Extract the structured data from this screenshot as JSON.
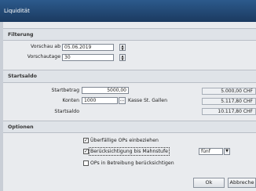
{
  "window": {
    "title": "Liquidität"
  },
  "filterung": {
    "title": "Filterung",
    "vorschau_ab_label": "Vorschau ab",
    "vorschau_ab_value": "05.06.2019",
    "vorschautage_label": "Vorschautage",
    "vorschautage_value": "30"
  },
  "startsaldo": {
    "title": "Startsaldo",
    "startbetrag_label": "Startbetrag",
    "startbetrag_value": "5000,00",
    "startbetrag_display": "5.000,00 CHF",
    "konten_label": "Konten",
    "konten_value": "1000",
    "konten_name": "Kasse St. Gallen",
    "konten_display": "5.117,80 CHF",
    "startsaldo_label": "Startsaldo",
    "startsaldo_display": "10.117,80 CHF"
  },
  "optionen": {
    "title": "Optionen",
    "opt1_label": "Überfällige OPs einbeziehen",
    "opt1_checked": "✓",
    "opt2_label": "Berücksichtigung bis Mahnstufe",
    "opt2_checked": "✓",
    "mahnstufe_value": "fünf",
    "opt3_label": "OPs in Betreibung berücksichtigen",
    "opt3_checked": ""
  },
  "buttons": {
    "ok": "Ok",
    "cancel": "Abbreche"
  },
  "icons": {
    "spinner": "spinner-arrows-icon",
    "dropdown": "chevron-down-icon",
    "browse": "ellipsis-icon",
    "check": "checkmark-icon"
  }
}
